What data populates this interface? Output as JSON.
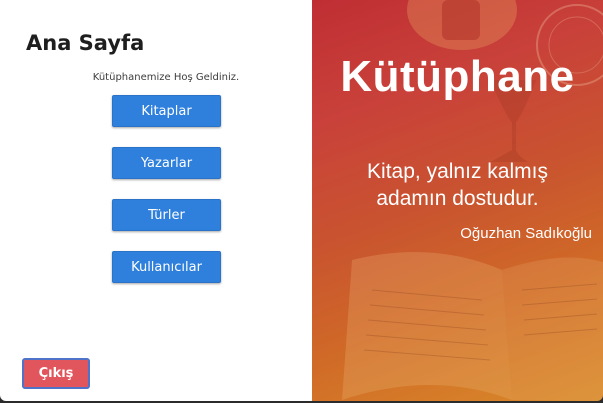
{
  "home": {
    "title": "Ana Sayfa",
    "welcome": "Kütüphanemize Hoş Geldiniz.",
    "buttons": {
      "books": "Kitaplar",
      "authors": "Yazarlar",
      "genres": "Türler",
      "users": "Kullanıcılar"
    },
    "exit": "Çıkış"
  },
  "banner": {
    "title": "Kütüphane",
    "quote_line1": "Kitap, yalnız kalmış",
    "quote_line2": "adamın dostudur.",
    "author": "Oğuzhan Sadıkoğlu"
  },
  "colors": {
    "primary_button": "#2f7fdc",
    "exit_button": "#e1555c",
    "banner_gradient_start": "#bf2e33",
    "banner_gradient_end": "#d98a2a"
  }
}
